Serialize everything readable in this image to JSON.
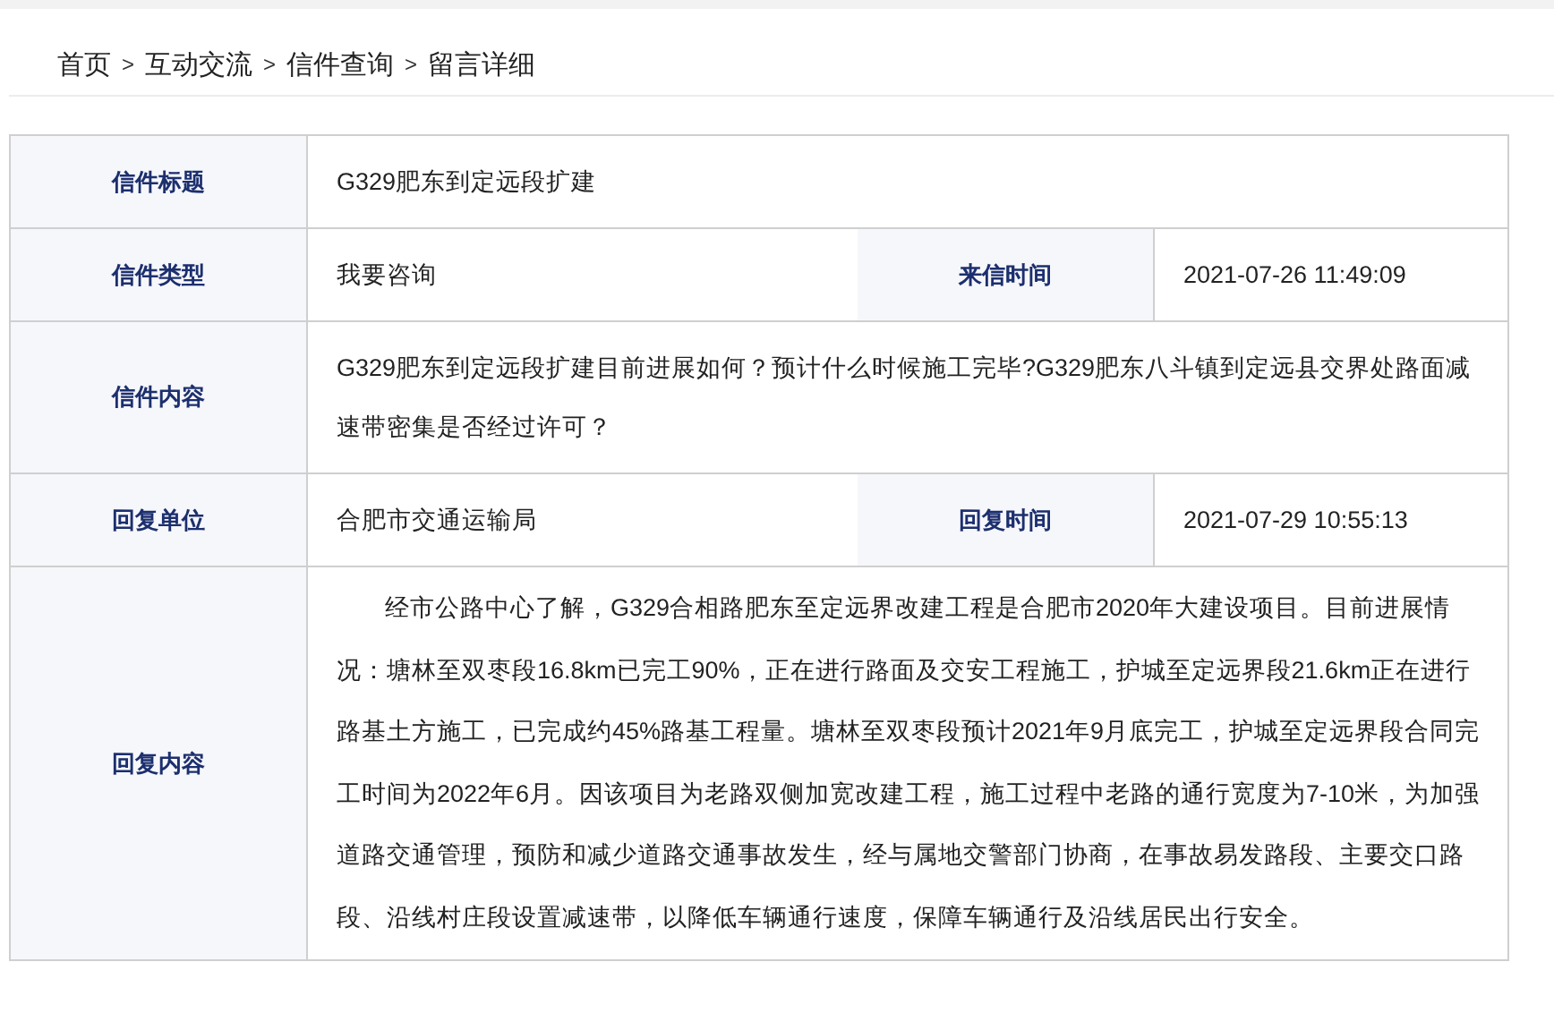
{
  "breadcrumb": {
    "separator": ">",
    "items": [
      "首页",
      "互动交流",
      "信件查询",
      "留言详细"
    ]
  },
  "rows": [
    {
      "fields": [
        {
          "label": "信件标题",
          "value": "G329肥东到定远段扩建"
        }
      ]
    },
    {
      "fields": [
        {
          "label": "信件类型",
          "value": "我要咨询"
        },
        {
          "label": "来信时间",
          "value": "2021-07-26 11:49:09"
        }
      ]
    },
    {
      "fields": [
        {
          "label": "信件内容",
          "value": "G329肥东到定远段扩建目前进展如何？预计什么时候施工完毕?G329肥东八斗镇到定远县交界处路面减速带密集是否经过许可？"
        }
      ]
    },
    {
      "fields": [
        {
          "label": "回复单位",
          "value": "合肥市交通运输局"
        },
        {
          "label": "回复时间",
          "value": "2021-07-29 10:55:13"
        }
      ]
    },
    {
      "fields": [
        {
          "label": "回复内容",
          "value": "经市公路中心了解，G329合相路肥东至定远界改建工程是合肥市2020年大建设项目。目前进展情况：塘林至双枣段16.8km已完工90%，正在进行路面及交安工程施工，护城至定远界段21.6km正在进行路基土方施工，已完成约45%路基工程量。塘林至双枣段预计2021年9月底完工，护城至定远界段合同完工时间为2022年6月。因该项目为老路双侧加宽改建工程，施工过程中老路的通行宽度为7-10米，为加强道路交通管理，预防和减少道路交通事故发生，经与属地交警部门协商，在事故易发路段、主要交口路段、沿线村庄段设置减速带，以降低车辆通行速度，保障车辆通行及沿线居民出行安全。",
          "indent": true
        }
      ]
    }
  ]
}
